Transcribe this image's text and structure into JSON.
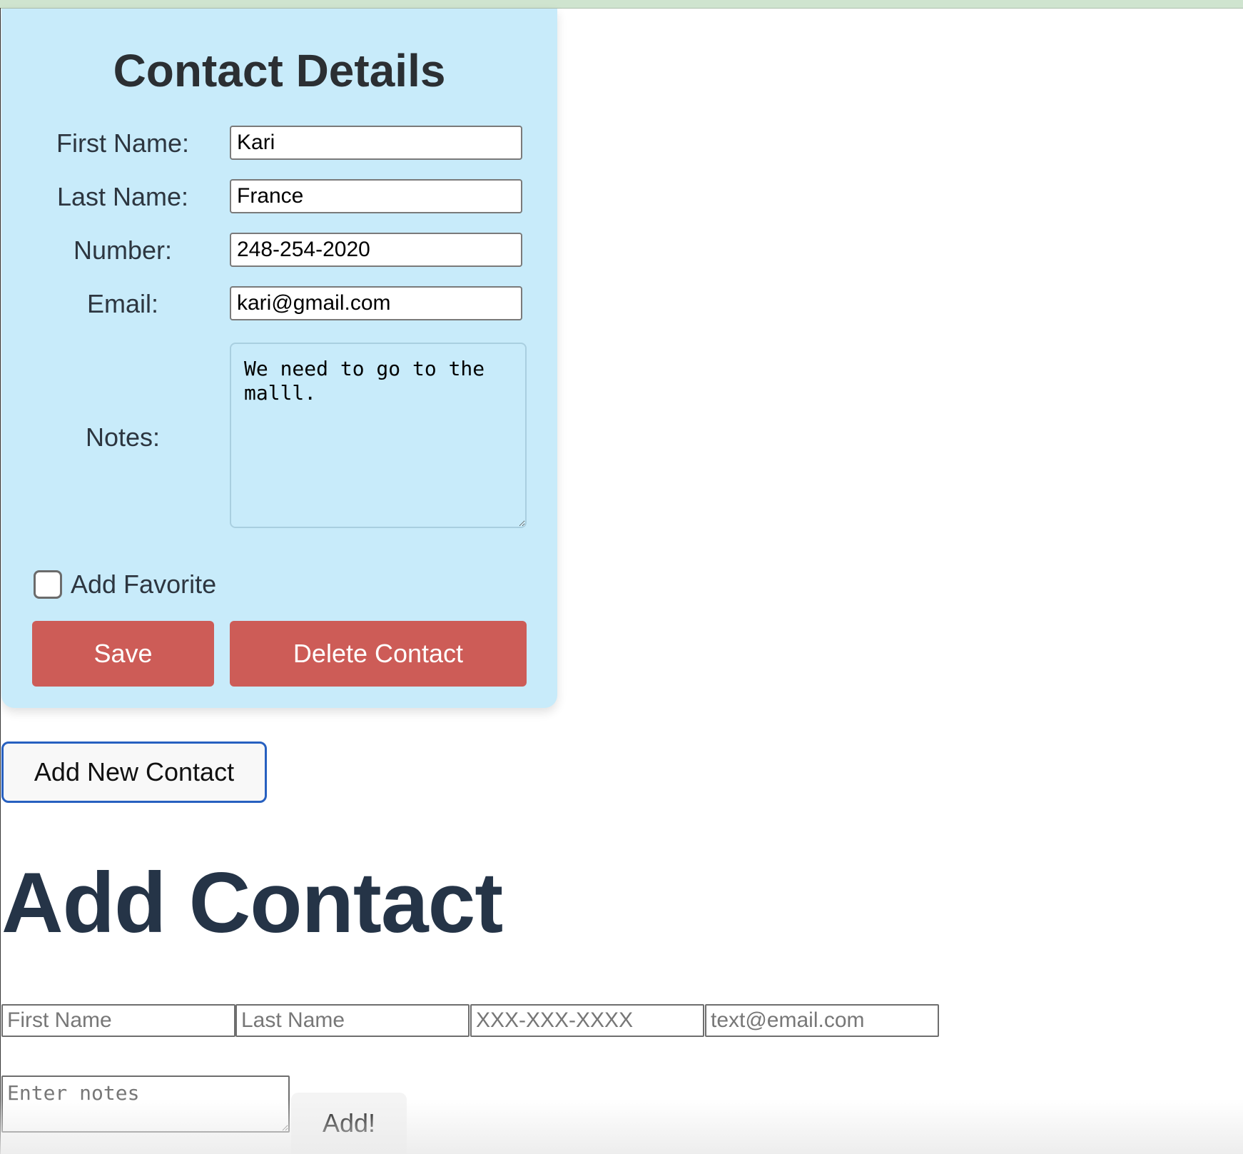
{
  "details": {
    "title": "Contact Details",
    "first_name_label": "First Name:",
    "first_name_value": "Kari",
    "last_name_label": "Last Name:",
    "last_name_value": "France",
    "number_label": "Number:",
    "number_value": "248-254-2020",
    "email_label": "Email:",
    "email_value": "kari@gmail.com",
    "notes_label": "Notes:",
    "notes_value": "We need to go to the malll.",
    "favorite_label": "Add Favorite",
    "favorite_checked": false,
    "save_label": "Save",
    "delete_label": "Delete Contact"
  },
  "add_new_button": "Add New Contact",
  "add_form": {
    "title": "Add Contact",
    "first_name_placeholder": "First Name",
    "last_name_placeholder": "Last Name",
    "number_placeholder": "XXX-XXX-XXXX",
    "email_placeholder": "text@email.com",
    "notes_placeholder": "Enter notes",
    "add_label": "Add!"
  },
  "colors": {
    "card_background": "#c8ebfa",
    "action_button": "#cd5c57",
    "focus_border": "#2760c0",
    "heading": "#253447"
  }
}
